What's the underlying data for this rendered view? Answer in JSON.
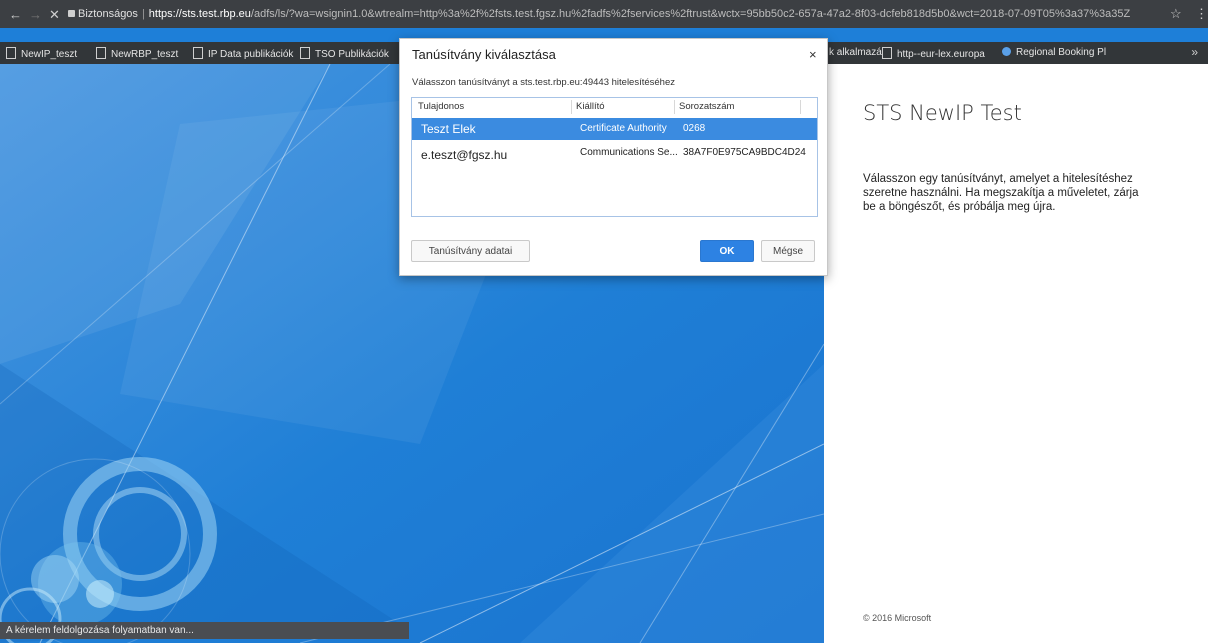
{
  "browser": {
    "back_icon": "←",
    "forward_icon": "→",
    "stop_icon": "✕",
    "secure_label": "Biztonságos",
    "url_host": "https://sts.test.rbp.eu",
    "url_rest": "/adfs/ls/?wa=wsignin1.0&wtrealm=http%3a%2f%2fsts.test.fgsz.hu%2fadfs%2fservices%2ftrust&wctx=95bb50c2-657a-47a2-8f03-dcfeb818d5b0&wct=2018-07-09T05%3a37%3a35Z",
    "star_icon": "☆",
    "menu_icon": "⋮",
    "bookmarks": [
      "NewIP_teszt",
      "NewRBP_teszt",
      "IP Data publikációk",
      "TSO Publikációk",
      "k alkalmazá",
      "http--eur-lex.europa",
      "Regional Booking Pl"
    ],
    "bookmarks_overflow": "»"
  },
  "dialog": {
    "title": "Tanúsítvány kiválasztása",
    "close_icon": "×",
    "subtitle": "Válasszon tanúsítványt a sts.test.rbp.eu:49443 hitelesítéséhez",
    "columns": [
      "Tulajdonos",
      "Kiállító",
      "Sorozatszám"
    ],
    "rows": [
      {
        "owner": "Teszt Elek",
        "issuer": "Certificate Authority",
        "serial": "0268"
      },
      {
        "owner": "e.teszt@fgsz.hu",
        "issuer": "Communications Se...",
        "serial": "38A7F0E975CA9BDC4D24"
      }
    ],
    "details_button": "Tanúsítvány adatai",
    "ok_button": "OK",
    "cancel_button": "Mégse"
  },
  "right_panel": {
    "title": "STS NewIP Test",
    "text": "Válasszon egy tanúsítványt, amelyet a hitelesítéshez szeretne használni. Ha megszakítja a műveletet, zárja be a böngészőt, és próbálja meg újra.",
    "copyright": "© 2016 Microsoft"
  },
  "status_bar": {
    "text": "A kérelem feldolgozása folyamatban van..."
  },
  "colors": {
    "background_blue": "#1e7fd8",
    "selection_blue": "#3b8be0",
    "ok_button_blue": "#2d82e3"
  }
}
